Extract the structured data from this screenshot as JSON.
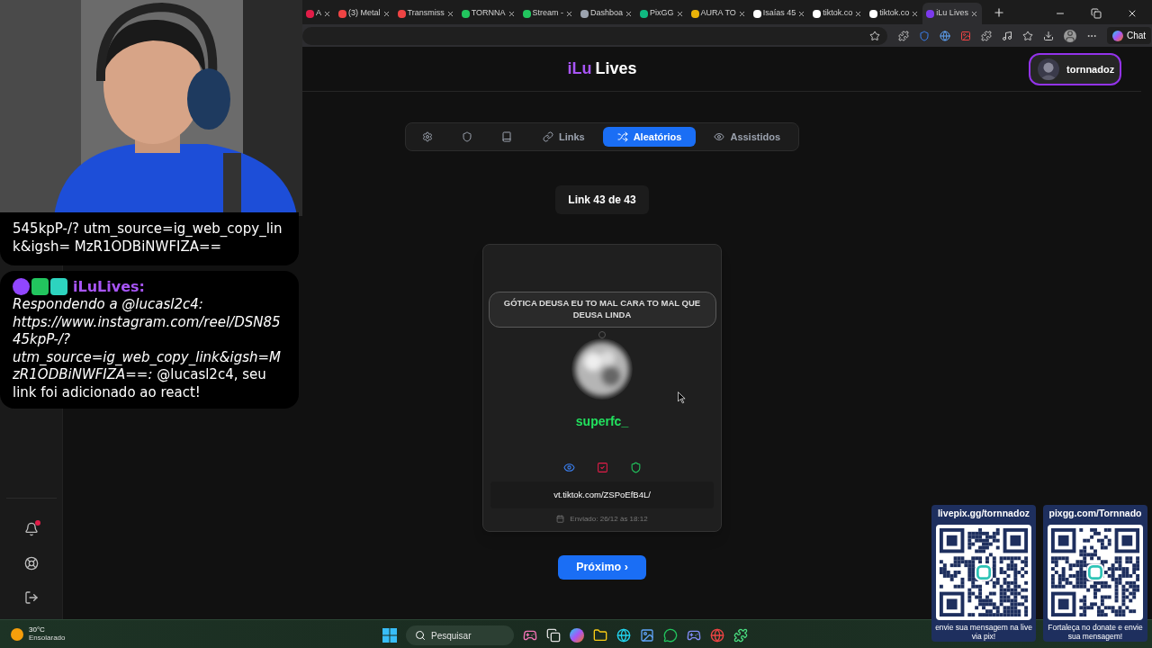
{
  "browser": {
    "tabs": [
      {
        "title": "A",
        "selected": false
      },
      {
        "title": "(3) Metal",
        "selected": false
      },
      {
        "title": "Transmiss",
        "selected": false
      },
      {
        "title": "TORNNA",
        "selected": false
      },
      {
        "title": "Stream -",
        "selected": false
      },
      {
        "title": "Dashboa",
        "selected": false
      },
      {
        "title": "PixGG",
        "selected": false
      },
      {
        "title": "AURA TO",
        "selected": false
      },
      {
        "title": "Isaías 45",
        "selected": false
      },
      {
        "title": "tiktok.co",
        "selected": false
      },
      {
        "title": "tiktok.co",
        "selected": false
      },
      {
        "title": "iLu Lives",
        "selected": true
      }
    ],
    "chat_button": "Chat"
  },
  "app": {
    "logo": {
      "accent": "iLu",
      "rest": "Lives"
    },
    "user": {
      "name": "tornnadoz"
    },
    "sidebar": {
      "has_notification": true
    },
    "tabs": [
      {
        "selected": false
      },
      {
        "selected": false
      },
      {
        "selected": false
      },
      {
        "label": "Links",
        "selected": false
      },
      {
        "label": "Aleatórios",
        "selected": true
      },
      {
        "label": "Assistidos",
        "selected": false
      }
    ],
    "counter": "Link 43 de 43",
    "card": {
      "caption": "GÓTICA DEUSA EU TO MAL CARA TO MAL QUE DEUSA LINDA",
      "username": "superfc_",
      "link": "vt.tiktok.com/ZSPoEfB4L/",
      "sent": "Enviado: 26/12 às 18:12"
    },
    "next_button": "Próximo ›"
  },
  "stream_overlay": {
    "chat": [
      {
        "kind": "continuation",
        "text": "545kpP-/? utm_source=ig_web_copy_link&igsh= MzR1ODBiNWFIZA=="
      },
      {
        "kind": "message",
        "author": "iLuLives:",
        "text": "*Respondendo a @lucasl2c4: https://www.instagram.com/reel/DSN8545kpP-/?utm_source=ig_web_copy_link&igsh=MzR1ODBiNWFIZA==:* @lucasl2c4, seu link foi adicionado ao react!"
      }
    ],
    "donations": [
      {
        "url": "livepix.gg/tornnadoz",
        "caption": "envie sua mensagem na live via pix!"
      },
      {
        "url": "pixgg.com/Tornnado",
        "caption": "Fortaleça no donate e envie sua mensagem!"
      }
    ]
  },
  "taskbar": {
    "weather": {
      "temperature": "30°C",
      "condition": "Ensolarado"
    },
    "search": {
      "placeholder": "Pesquisar"
    }
  }
}
